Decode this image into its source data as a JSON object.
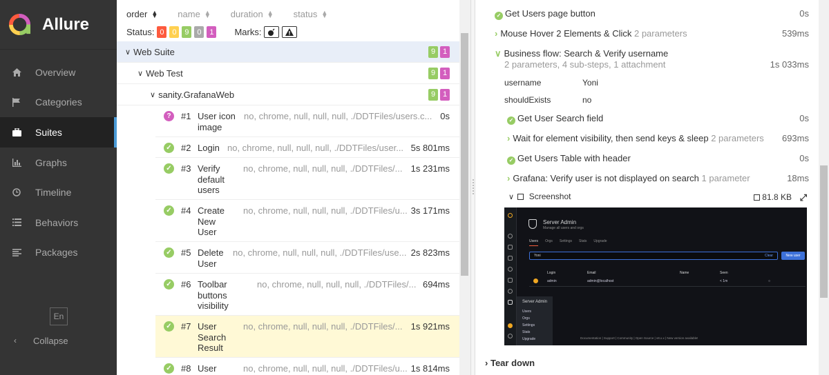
{
  "app": {
    "name": "Allure"
  },
  "sidebar": {
    "items": [
      {
        "label": "Overview",
        "icon": "home-icon"
      },
      {
        "label": "Categories",
        "icon": "flag-icon"
      },
      {
        "label": "Suites",
        "icon": "briefcase-icon"
      },
      {
        "label": "Graphs",
        "icon": "bar-chart-icon"
      },
      {
        "label": "Timeline",
        "icon": "clock-icon"
      },
      {
        "label": "Behaviors",
        "icon": "list-icon"
      },
      {
        "label": "Packages",
        "icon": "align-left-icon"
      }
    ],
    "active_index": 2,
    "language": "En",
    "collapse_label": "Collapse"
  },
  "tree": {
    "sort": [
      "order",
      "name",
      "duration",
      "status"
    ],
    "status_label": "Status:",
    "status_counts": {
      "failed": "0",
      "broken": "0",
      "passed": "9",
      "skipped": "0",
      "unknown": "1"
    },
    "marks_label": "Marks:",
    "groups": [
      {
        "label": "Web Suite",
        "passed": "9",
        "unknown": "1"
      },
      {
        "label": "Web Test",
        "passed": "9",
        "unknown": "1"
      },
      {
        "label": "sanity.GrafanaWeb",
        "passed": "9",
        "unknown": "1"
      }
    ],
    "tests": [
      {
        "num": "#1",
        "name": "User icon image",
        "params": "no, chrome, null, null, null, ./DDTFiles/users.c...",
        "duration": "0s",
        "status": "unknown"
      },
      {
        "num": "#2",
        "name": "Login",
        "params": "no, chrome, null, null, null, ./DDTFiles/user...",
        "duration": "5s 801ms",
        "status": "passed"
      },
      {
        "num": "#3",
        "name": "Verify default users",
        "params": "no, chrome, null, null, null, ./DDTFiles/...",
        "duration": "1s 231ms",
        "status": "passed"
      },
      {
        "num": "#4",
        "name": "Create New User",
        "params": "no, chrome, null, null, null, ./DDTFiles/u...",
        "duration": "3s 171ms",
        "status": "passed"
      },
      {
        "num": "#5",
        "name": "Delete User",
        "params": "no, chrome, null, null, null, ./DDTFiles/use...",
        "duration": "2s 823ms",
        "status": "passed"
      },
      {
        "num": "#6",
        "name": "Toolbar buttons visibility",
        "params": "no, chrome, null, null, null, ./DDTFiles/...",
        "duration": "694ms",
        "status": "passed"
      },
      {
        "num": "#7",
        "name": "User Search Result",
        "params": "no, chrome, null, null, null, ./DDTFiles/...",
        "duration": "1s 921ms",
        "status": "passed"
      },
      {
        "num": "#8",
        "name": "User",
        "params": "no, chrome, null, null, null, ./DDTFiles/u...",
        "duration": "1s 814ms",
        "status": "passed"
      }
    ]
  },
  "detail": {
    "steps": {
      "get_users_page": {
        "label": "Get Users page button",
        "duration": "0s"
      },
      "mouse_hover": {
        "label": "Mouse Hover 2 Elements & Click",
        "note": "2 parameters",
        "duration": "539ms"
      },
      "business_flow": {
        "label": "Business flow: Search & Verify username",
        "note": "2 parameters, 4 sub-steps, 1 attachment",
        "duration": "1s 033ms"
      },
      "get_user_search": {
        "label": "Get User Search field",
        "duration": "0s"
      },
      "wait_visibility": {
        "label": "Wait for element visibility, then send keys & sleep",
        "note": "2 parameters",
        "duration": "693ms"
      },
      "get_users_table": {
        "label": "Get Users Table with header",
        "duration": "0s"
      },
      "grafana_verify": {
        "label": "Grafana: Verify user is not displayed on search",
        "note": "1 parameter",
        "duration": "18ms"
      }
    },
    "params": [
      {
        "key": "username",
        "value": "Yoni"
      },
      {
        "key": "shouldExists",
        "value": "no"
      }
    ],
    "attachment": {
      "label": "Screenshot",
      "size": "81.8 KB"
    },
    "teardown": "Tear down"
  },
  "screenshot": {
    "title": "Server Admin",
    "subtitle": "Manage all users and orgs",
    "tabs": [
      "Users",
      "Orgs",
      "Settings",
      "Stats",
      "Upgrade"
    ],
    "search_value": "Yoni",
    "clear": "Clear",
    "new_user": "New user",
    "headers": [
      "Login",
      "Email",
      "Name",
      "Seen"
    ],
    "row": {
      "login": "admin",
      "email": "admin@localhost",
      "seen": "< 1m"
    },
    "menu": [
      "Server Admin",
      "Users",
      "Orgs",
      "Settings",
      "Stats",
      "Upgrade"
    ],
    "footer": "Documentation | Support | Community | Open Source | v8.x.x | New version available!"
  }
}
